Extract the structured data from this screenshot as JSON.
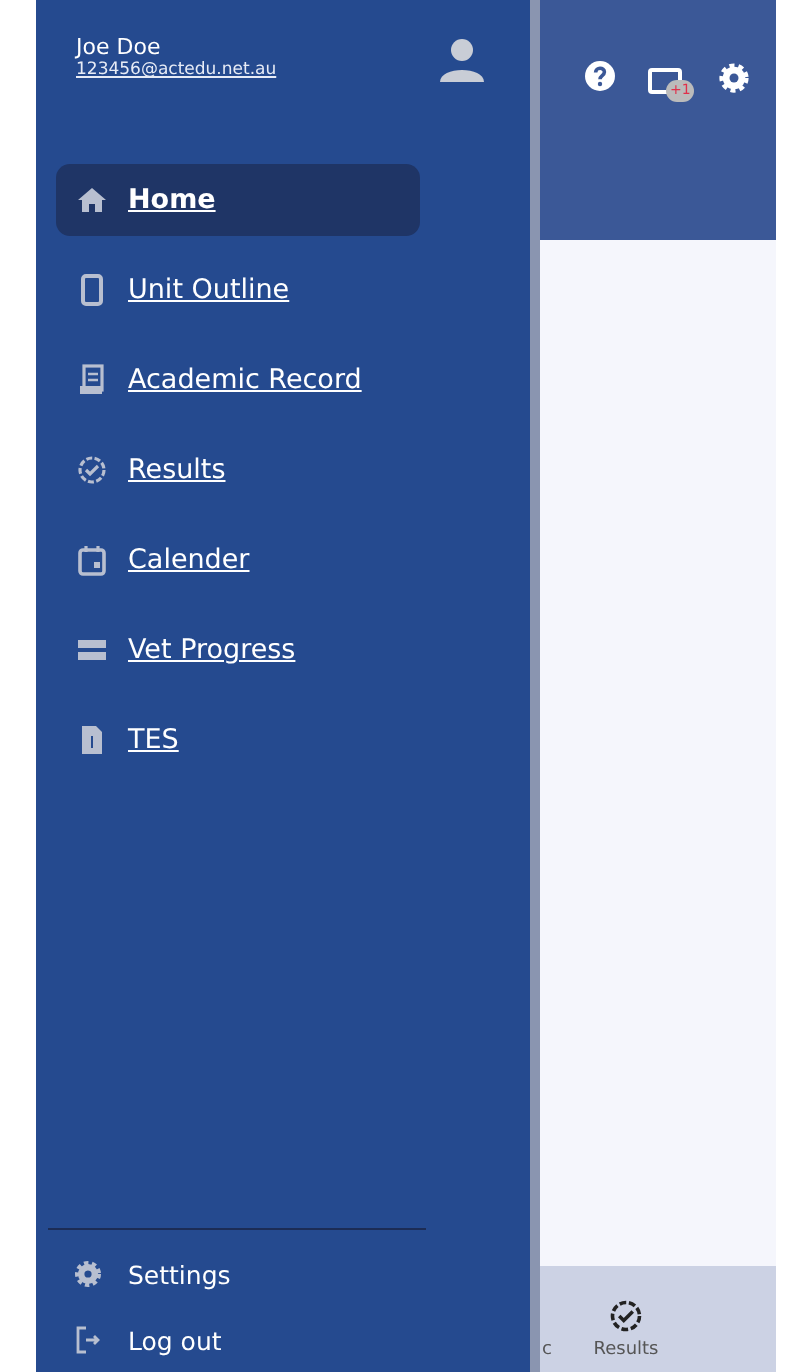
{
  "drawer": {
    "user": {
      "name": "Joe Doe",
      "email": "123456@actedu.net.au"
    },
    "items": [
      {
        "label": "Home",
        "kind": "home",
        "selected": true
      },
      {
        "label": "Unit Outline",
        "kind": "phone",
        "selected": false
      },
      {
        "label": "Academic Record",
        "kind": "record",
        "selected": false
      },
      {
        "label": "Results",
        "kind": "badge",
        "selected": false
      },
      {
        "label": "Calender",
        "kind": "calendar",
        "selected": false
      },
      {
        "label": "Vet Progress",
        "kind": "storage",
        "selected": false
      },
      {
        "label": "TES",
        "kind": "file",
        "selected": false
      }
    ],
    "footer": [
      {
        "label": "Settings",
        "kind": "gear"
      },
      {
        "label": "Log out",
        "kind": "logout"
      }
    ]
  },
  "app_bar": {
    "notification_badge": "+1"
  },
  "bottom_nav": [
    {
      "label": "c",
      "kind": "text"
    },
    {
      "label": "Results",
      "kind": "badge"
    }
  ]
}
